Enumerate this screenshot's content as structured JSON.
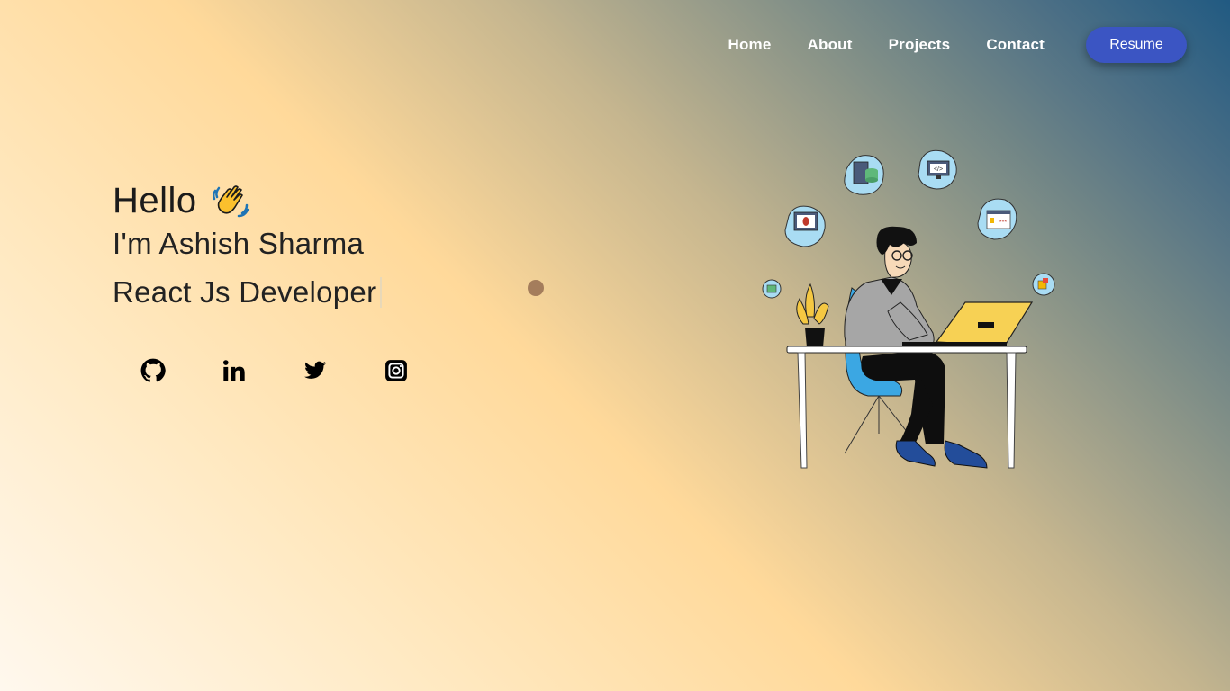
{
  "nav": {
    "links": [
      {
        "label": "Home"
      },
      {
        "label": "About"
      },
      {
        "label": "Projects"
      },
      {
        "label": "Contact"
      }
    ],
    "resume_label": "Resume"
  },
  "hero": {
    "greeting": "Hello",
    "greeting_icon": "waving-hand-icon",
    "name": "I'm Ashish Sharma",
    "role": "React Js Developer"
  },
  "socials": [
    {
      "icon": "github-icon"
    },
    {
      "icon": "linkedin-icon"
    },
    {
      "icon": "twitter-icon"
    },
    {
      "icon": "instagram-icon"
    }
  ],
  "colors": {
    "accent": "#3b55c3",
    "gradient_start": "#fff8ee",
    "gradient_mid": "#ffd99a",
    "gradient_end": "#215a82",
    "dot": "#a47d5c"
  },
  "illustration": {
    "subject": "developer-at-desk-illustration",
    "icons": [
      "server-database-icon",
      "code-monitor-icon",
      "password-window-icon",
      "bug-monitor-icon",
      "lock-cube-icon",
      "bug-small-icon"
    ]
  }
}
